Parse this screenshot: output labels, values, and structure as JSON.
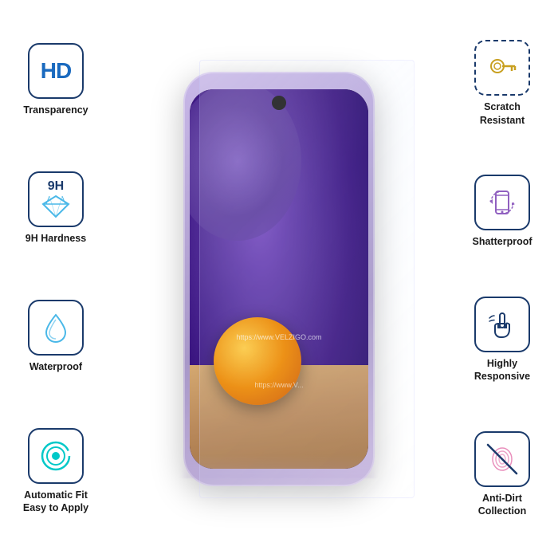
{
  "features_left": [
    {
      "id": "hd-transparency",
      "icon_type": "hd",
      "label": "Transparency"
    },
    {
      "id": "9h-hardness",
      "icon_type": "diamond",
      "label": "9H Hardness"
    },
    {
      "id": "waterproof",
      "icon_type": "waterdrop",
      "label": "Waterproof"
    },
    {
      "id": "auto-fit",
      "icon_type": "autofit",
      "label": "Automatic Fit\nEasy to Apply"
    }
  ],
  "features_right": [
    {
      "id": "scratch-resistant",
      "icon_type": "key",
      "label": "Scratch\nResistant",
      "border": "dashed"
    },
    {
      "id": "shatterproof",
      "icon_type": "phone-rotate",
      "label": "Shatterproof"
    },
    {
      "id": "highly-responsive",
      "icon_type": "touch",
      "label": "Highly\nResponsive"
    },
    {
      "id": "anti-dirt",
      "icon_type": "fingerprint",
      "label": "Anti-Dirt\nCollection"
    }
  ],
  "watermark": "https://www.VELZIGO.com",
  "watermark2": "https://www.V...",
  "brand": "VELZIGO"
}
